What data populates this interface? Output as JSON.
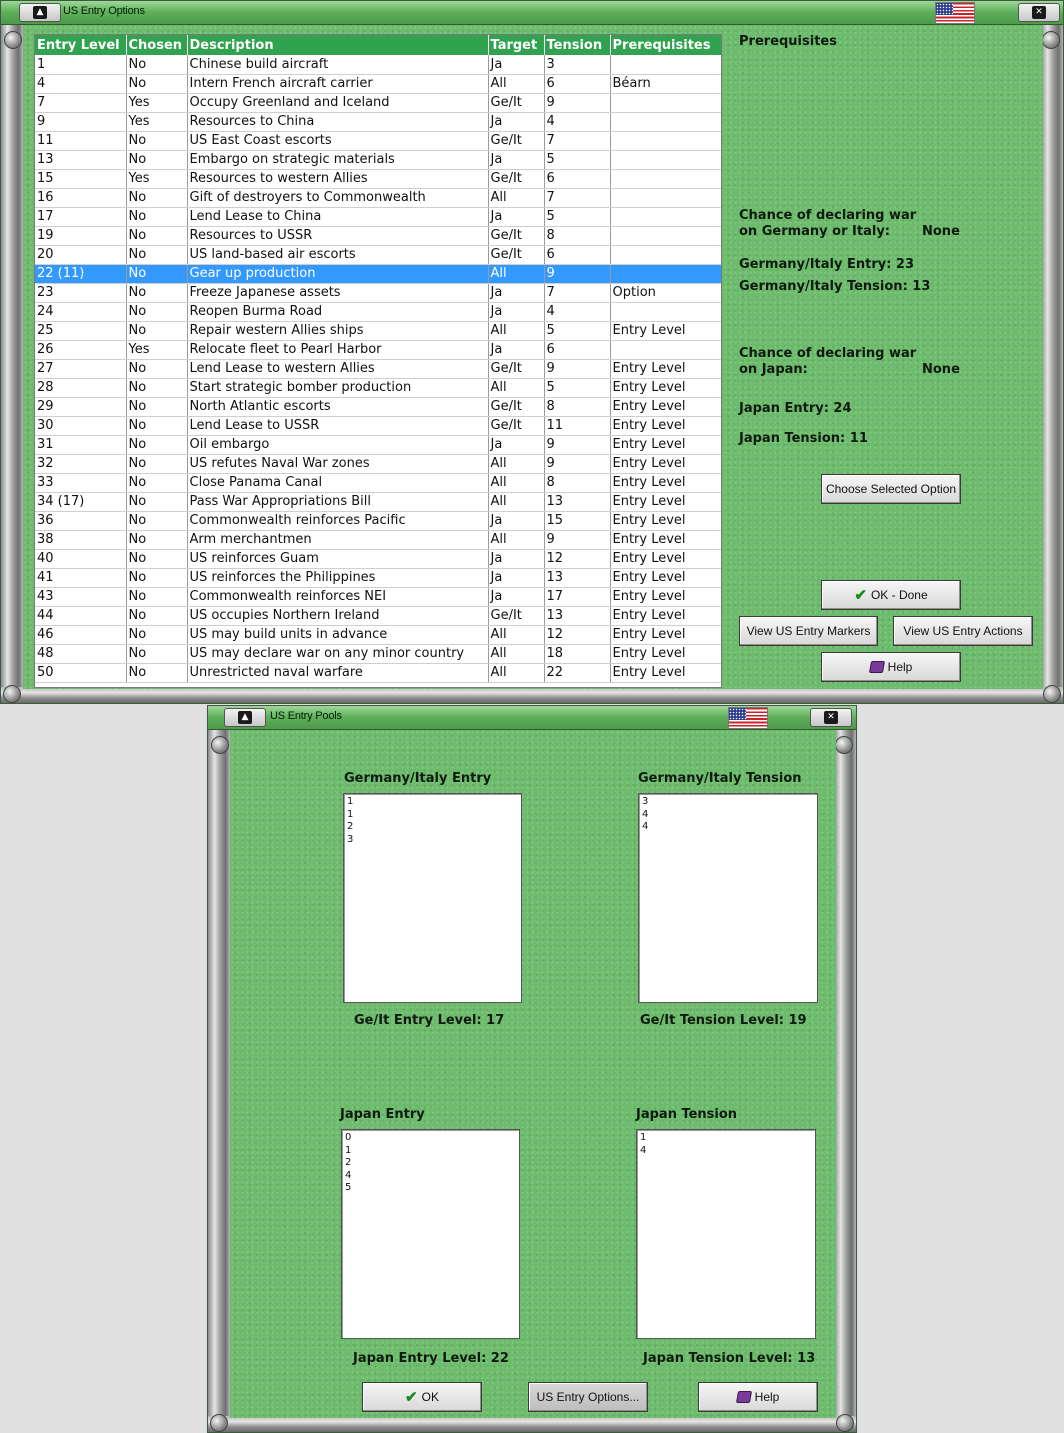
{
  "options_window": {
    "title": "US Entry Options",
    "columns": [
      "Entry Level",
      "Chosen",
      "Description",
      "Target",
      "Tension",
      "Prerequisites"
    ],
    "rows": [
      [
        "1",
        "No",
        "Chinese build aircraft",
        "Ja",
        "3",
        ""
      ],
      [
        "4",
        "No",
        "Intern French aircraft carrier",
        "All",
        "6",
        "Béarn"
      ],
      [
        "7",
        "Yes",
        "Occupy Greenland and Iceland",
        "Ge/It",
        "9",
        ""
      ],
      [
        "9",
        "Yes",
        "Resources to China",
        "Ja",
        "4",
        ""
      ],
      [
        "11",
        "No",
        "US East Coast escorts",
        "Ge/It",
        "7",
        ""
      ],
      [
        "13",
        "No",
        "Embargo on strategic materials",
        "Ja",
        "5",
        ""
      ],
      [
        "15",
        "Yes",
        "Resources to western Allies",
        "Ge/It",
        "6",
        ""
      ],
      [
        "16",
        "No",
        "Gift of destroyers to Commonwealth",
        "All",
        "7",
        ""
      ],
      [
        "17",
        "No",
        "Lend Lease to China",
        "Ja",
        "5",
        ""
      ],
      [
        "19",
        "No",
        "Resources to USSR",
        "Ge/It",
        "8",
        ""
      ],
      [
        "20",
        "No",
        "US land-based air escorts",
        "Ge/It",
        "6",
        ""
      ],
      [
        "22 (11)",
        "No",
        "Gear up production",
        "All",
        "9",
        ""
      ],
      [
        "23",
        "No",
        "Freeze Japanese assets",
        "Ja",
        "7",
        "Option"
      ],
      [
        "24",
        "No",
        "Reopen Burma Road",
        "Ja",
        "4",
        ""
      ],
      [
        "25",
        "No",
        "Repair western Allies ships",
        "All",
        "5",
        "Entry Level"
      ],
      [
        "26",
        "Yes",
        "Relocate fleet to Pearl Harbor",
        "Ja",
        "6",
        ""
      ],
      [
        "27",
        "No",
        "Lend Lease to western Allies",
        "Ge/It",
        "9",
        "Entry Level"
      ],
      [
        "28",
        "No",
        "Start strategic bomber production",
        "All",
        "5",
        "Entry Level"
      ],
      [
        "29",
        "No",
        "North Atlantic escorts",
        "Ge/It",
        "8",
        "Entry Level"
      ],
      [
        "30",
        "No",
        "Lend Lease to USSR",
        "Ge/It",
        "11",
        "Entry Level"
      ],
      [
        "31",
        "No",
        "Oil embargo",
        "Ja",
        "9",
        "Entry Level"
      ],
      [
        "32",
        "No",
        "US refutes Naval War zones",
        "All",
        "9",
        "Entry Level"
      ],
      [
        "33",
        "No",
        "Close Panama Canal",
        "All",
        "8",
        "Entry Level"
      ],
      [
        "34 (17)",
        "No",
        "Pass War Appropriations Bill",
        "All",
        "13",
        "Entry Level"
      ],
      [
        "36",
        "No",
        "Commonwealth reinforces Pacific",
        "Ja",
        "15",
        "Entry Level"
      ],
      [
        "38",
        "No",
        "Arm merchantmen",
        "All",
        "9",
        "Entry Level"
      ],
      [
        "40",
        "No",
        "US reinforces Guam",
        "Ja",
        "12",
        "Entry Level"
      ],
      [
        "41",
        "No",
        "US reinforces the Philippines",
        "Ja",
        "13",
        "Entry Level"
      ],
      [
        "43",
        "No",
        "Commonwealth reinforces NEI",
        "Ja",
        "17",
        "Entry Level"
      ],
      [
        "44",
        "No",
        "US occupies Northern Ireland",
        "Ge/It",
        "13",
        "Entry Level"
      ],
      [
        "46",
        "No",
        "US may build units in advance",
        "All",
        "12",
        "Entry Level"
      ],
      [
        "48",
        "No",
        "US may declare war on any minor country",
        "All",
        "18",
        "Entry Level"
      ],
      [
        "50",
        "No",
        "Unrestricted naval warfare",
        "All",
        "22",
        "Entry Level"
      ]
    ],
    "selected_row_index": 11,
    "side": {
      "prereq_heading": "Prerequisites",
      "chance_ge_line1": "Chance of declaring war",
      "chance_ge_line2": "on Germany or Italy:",
      "chance_ge_value": "None",
      "ge_entry": "Germany/Italy Entry: 23",
      "ge_tension": "Germany/Italy Tension: 13",
      "chance_ja_line1": "Chance of declaring war",
      "chance_ja_line2": "on Japan:",
      "chance_ja_value": "None",
      "ja_entry": "Japan Entry: 24",
      "ja_tension": "Japan Tension: 11"
    },
    "buttons": {
      "choose": "Choose Selected Option",
      "ok_done": "OK - Done",
      "view_markers": "View US Entry Markers",
      "view_actions": "View US Entry Actions",
      "help": "Help"
    }
  },
  "pools_window": {
    "title": "US Entry Pools",
    "ge_entry_title": "Germany/Italy Entry",
    "ge_entry_items": [
      "1",
      "1",
      "2",
      "3"
    ],
    "ge_entry_level": "Ge/It Entry Level: 17",
    "ge_tension_title": "Germany/Italy Tension",
    "ge_tension_items": [
      "3",
      "4",
      "4"
    ],
    "ge_tension_level": "Ge/It Tension Level: 19",
    "ja_entry_title": "Japan Entry",
    "ja_entry_items": [
      "0",
      "1",
      "2",
      "4",
      "5"
    ],
    "ja_entry_level": "Japan Entry Level: 22",
    "ja_tension_title": "Japan Tension",
    "ja_tension_items": [
      "1",
      "4"
    ],
    "ja_tension_level": "Japan Tension Level: 13",
    "buttons": {
      "ok": "OK",
      "options": "US Entry Options...",
      "help": "Help"
    }
  },
  "icons": {
    "minimize": "window-minimize-icon",
    "close": "window-close-icon",
    "flag": "us-flag-icon",
    "ok": "checkmark-icon",
    "help": "help-book-icon"
  }
}
